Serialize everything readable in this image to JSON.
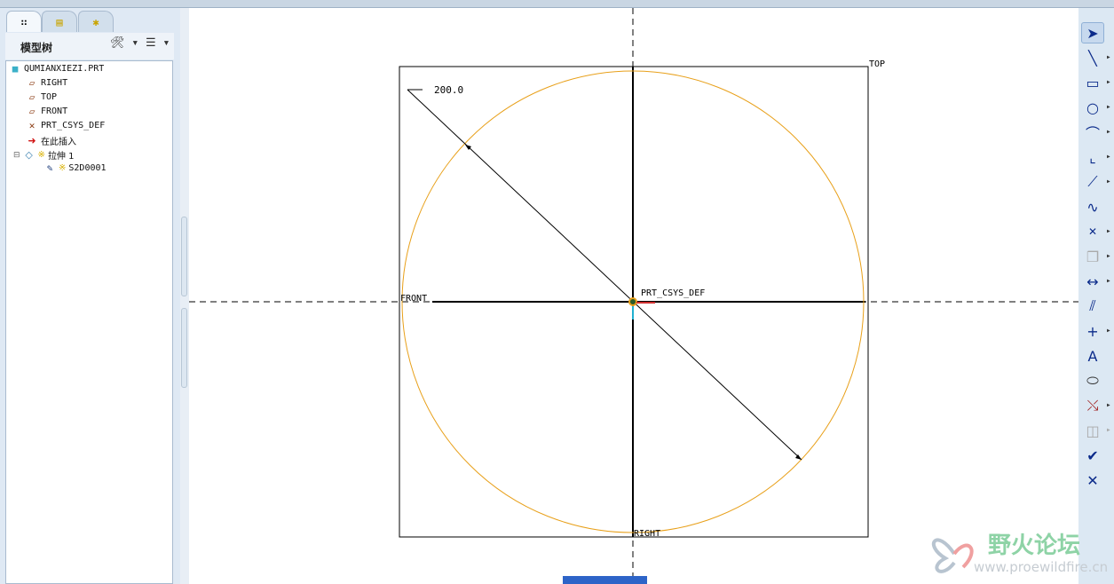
{
  "model_tree": {
    "tabs": [
      {
        "icon": "model-tree-icon"
      },
      {
        "icon": "folder-browser-icon"
      },
      {
        "icon": "favorites-folder-icon"
      }
    ],
    "title": "模型树",
    "nodes": [
      {
        "label": "QUMIANXIEZI.PRT",
        "icon": "part-icon"
      },
      {
        "label": "RIGHT",
        "icon": "datum-plane-icon"
      },
      {
        "label": "TOP",
        "icon": "datum-plane-icon"
      },
      {
        "label": "FRONT",
        "icon": "datum-plane-icon"
      },
      {
        "label": "PRT_CSYS_DEF",
        "icon": "csys-icon"
      },
      {
        "label": "在此插入",
        "icon": "insert-here-arrow-icon"
      },
      {
        "label": "拉伸 1",
        "icon": "extrude-icon",
        "prefix": "※"
      },
      {
        "label": "S2D0001",
        "icon": "sketch-icon",
        "prefix": "※"
      }
    ]
  },
  "sketch": {
    "dimension": "200.0",
    "labels": {
      "top": "TOP",
      "front": "FRONT",
      "right": "RIGHT",
      "csys": "PRT_CSYS_DEF"
    },
    "circle_color": "#e8a01a"
  },
  "sketch_toolbar": [
    "select-arrow-icon",
    "line-icon",
    "rectangle-icon",
    "circle-icon",
    "arc-icon",
    "fillet-icon",
    "chamfer-icon",
    "spline-icon",
    "point-icon",
    "offset-edge-icon",
    "dimension-icon",
    "modify-icon",
    "constraint-icon",
    "text-icon",
    "palette-icon",
    "trim-icon",
    "mirror-icon",
    "accept-check-icon",
    "cancel-x-icon"
  ],
  "watermark": {
    "title": "野火论坛",
    "url": "www.proewildfire.cn"
  }
}
